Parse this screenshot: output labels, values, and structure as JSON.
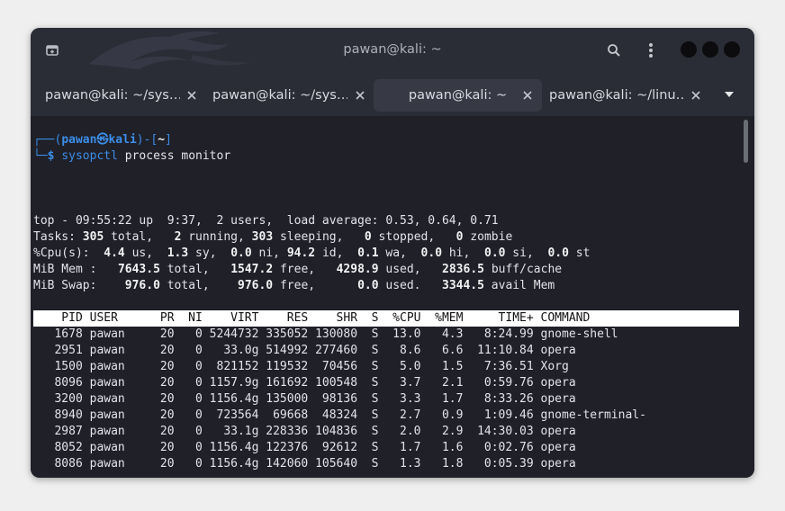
{
  "window": {
    "title": "pawan@kali: ~"
  },
  "icons": {
    "new_tab": "new-tab-icon",
    "search": "search-icon",
    "menu": "vertical-dots-icon",
    "tab_close": "close-icon",
    "tab_overflow": "chevron-down-icon"
  },
  "colors": {
    "window_bg": "#2b2d36",
    "terminal_bg": "#1f2028",
    "prompt_blue": "#3c8ee8",
    "text": "#e3e4e8"
  },
  "tabs": [
    {
      "label": "pawan@kali: ~/sys…",
      "active": false
    },
    {
      "label": "pawan@kali: ~/sys…",
      "active": false
    },
    {
      "label": "pawan@kali: ~",
      "active": true
    },
    {
      "label": "pawan@kali: ~/linu…",
      "active": false
    }
  ],
  "terminal": {
    "prompt": {
      "open": "┌──(",
      "user": "pawan",
      "at": "㉿",
      "host": "kali",
      "mid": ")-[",
      "dir": "~",
      "close": "]",
      "arrow": "└─",
      "dollar": "$"
    },
    "command": {
      "name": "sysopctl",
      "args": " process monitor"
    },
    "top_summary": {
      "line1": "top - 09:55:22 up  9:37,  2 users,  load average: 0.53, 0.64, 0.71",
      "tasks": {
        "label": "Tasks:",
        "total": "305",
        "running": "2",
        "sleeping": "303",
        "stopped": "0",
        "zombie": "0"
      },
      "cpu": {
        "label": "%Cpu(s):",
        "us": "4.4",
        "sy": "1.3",
        "ni": "0.0",
        "id": "94.2",
        "wa": "0.1",
        "hi": "0.0",
        "si": "0.0",
        "st": "0.0"
      },
      "mem": {
        "label": "MiB Mem :",
        "total": "7643.5",
        "free": "1547.2",
        "used": "4298.9",
        "buff_cache": "2836.5"
      },
      "swap": {
        "label": "MiB Swap:",
        "total": "976.0",
        "free": "976.0",
        "used": "0.0",
        "avail": "3344.5"
      }
    },
    "process_table": {
      "columns": [
        "PID",
        "USER",
        "PR",
        "NI",
        "VIRT",
        "RES",
        "SHR",
        "S",
        "%CPU",
        "%MEM",
        "TIME+",
        "COMMAND"
      ],
      "rows": [
        [
          "1678",
          "pawan",
          "20",
          "0",
          "5244732",
          "335052",
          "130080",
          "S",
          "13.0",
          "4.3",
          "8:24.99",
          "gnome-shell"
        ],
        [
          "2951",
          "pawan",
          "20",
          "0",
          "33.0g",
          "514992",
          "277460",
          "S",
          "8.6",
          "6.6",
          "11:10.84",
          "opera"
        ],
        [
          "1500",
          "pawan",
          "20",
          "0",
          "821152",
          "119532",
          "70456",
          "S",
          "5.0",
          "1.5",
          "7:36.51",
          "Xorg"
        ],
        [
          "8096",
          "pawan",
          "20",
          "0",
          "1157.9g",
          "161692",
          "100548",
          "S",
          "3.7",
          "2.1",
          "0:59.76",
          "opera"
        ],
        [
          "3200",
          "pawan",
          "20",
          "0",
          "1156.4g",
          "135000",
          "98136",
          "S",
          "3.3",
          "1.7",
          "8:33.26",
          "opera"
        ],
        [
          "8940",
          "pawan",
          "20",
          "0",
          "723564",
          "69668",
          "48324",
          "S",
          "2.7",
          "0.9",
          "1:09.46",
          "gnome-terminal-"
        ],
        [
          "2987",
          "pawan",
          "20",
          "0",
          "33.1g",
          "228336",
          "104836",
          "S",
          "2.0",
          "2.9",
          "14:30.03",
          "opera"
        ],
        [
          "8052",
          "pawan",
          "20",
          "0",
          "1156.4g",
          "122376",
          "92612",
          "S",
          "1.7",
          "1.6",
          "0:02.76",
          "opera"
        ],
        [
          "8086",
          "pawan",
          "20",
          "0",
          "1156.4g",
          "142060",
          "105640",
          "S",
          "1.3",
          "1.8",
          "0:05.39",
          "opera"
        ]
      ]
    }
  }
}
